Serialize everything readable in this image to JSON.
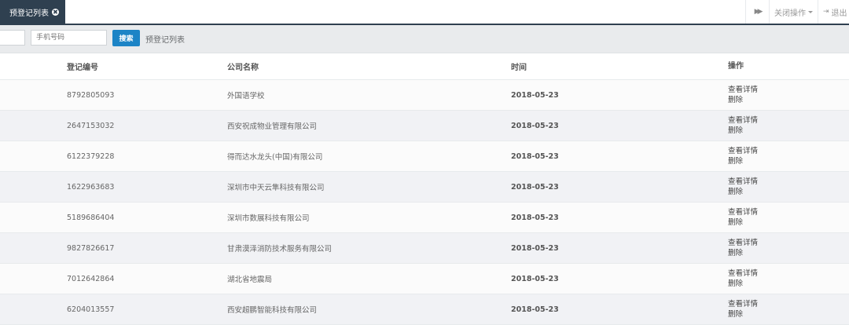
{
  "tabs": {
    "active_label": "预登记列表",
    "close_glyph": "✖",
    "forward_glyph": "▶▶",
    "close_ops_label": "关闭操作",
    "logout_glyph": "⇥",
    "logout_label": "退出"
  },
  "search": {
    "phone_placeholder": "手机号码",
    "button_label": "搜索",
    "breadcrumb": "预登记列表"
  },
  "table": {
    "headers": {
      "id": "登记编号",
      "company": "公司名称",
      "time": "时间",
      "ops": "操作"
    },
    "op_labels": {
      "view": "查看详情",
      "delete": "删除"
    },
    "rows": [
      {
        "id": "8792805093",
        "company": "外国语学校",
        "time": "2018-05-23"
      },
      {
        "id": "2647153032",
        "company": "西安祝成物业管理有限公司",
        "time": "2018-05-23"
      },
      {
        "id": "6122379228",
        "company": "得而达水龙头(中国)有限公司",
        "time": "2018-05-23"
      },
      {
        "id": "1622963683",
        "company": "深圳市中天云隼科技有限公司",
        "time": "2018-05-23"
      },
      {
        "id": "5189686404",
        "company": "深圳市数展科技有限公司",
        "time": "2018-05-23"
      },
      {
        "id": "9827826617",
        "company": "甘肃漠泽消防技术服务有限公司",
        "time": "2018-05-23"
      },
      {
        "id": "7012642864",
        "company": "湖北省地震局",
        "time": "2018-05-23"
      },
      {
        "id": "6204013557",
        "company": "西安超鹏智能科技有限公司",
        "time": "2018-05-23"
      }
    ]
  },
  "colors": {
    "nav_dark": "#2f4050",
    "primary_button": "#1c84c6"
  }
}
